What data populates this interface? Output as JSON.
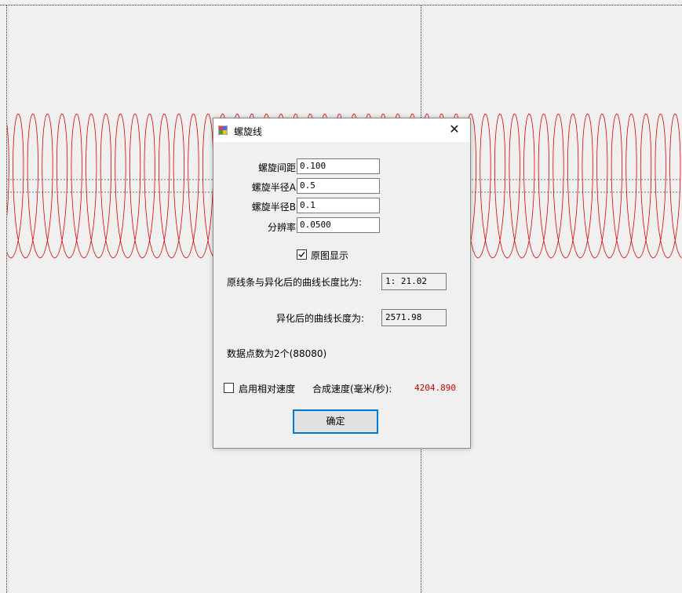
{
  "dialog": {
    "title": "螺旋线",
    "close_glyph": "✕",
    "fields": [
      {
        "label": "螺旋间距",
        "value": "0.100"
      },
      {
        "label": "螺旋半径A",
        "value": "0.5"
      },
      {
        "label": "螺旋半径B",
        "value": "0.1"
      },
      {
        "label": "分辨率",
        "value": "0.0500"
      }
    ],
    "original_display": {
      "label": "原图显示",
      "checked": true
    },
    "ratio": {
      "label": "原线条与异化后的曲线长度比为:",
      "value": "1: 21.02"
    },
    "length": {
      "label": "异化后的曲线长度为:",
      "value": "2571.98"
    },
    "points_text": "数据点数为2个(88080)",
    "relative_speed": {
      "label": "启用相对速度",
      "checked": false
    },
    "speed": {
      "label": "合成速度(毫米/秒):",
      "value": "4204.890"
    },
    "ok_label": "确定"
  },
  "colors": {
    "spiral": "#e00000",
    "speed_value": "#cc0000",
    "ok_border": "#0078d7"
  },
  "icons": {
    "title_icon": "app-window-icon",
    "close": "close-icon",
    "check": "checkmark-icon"
  }
}
